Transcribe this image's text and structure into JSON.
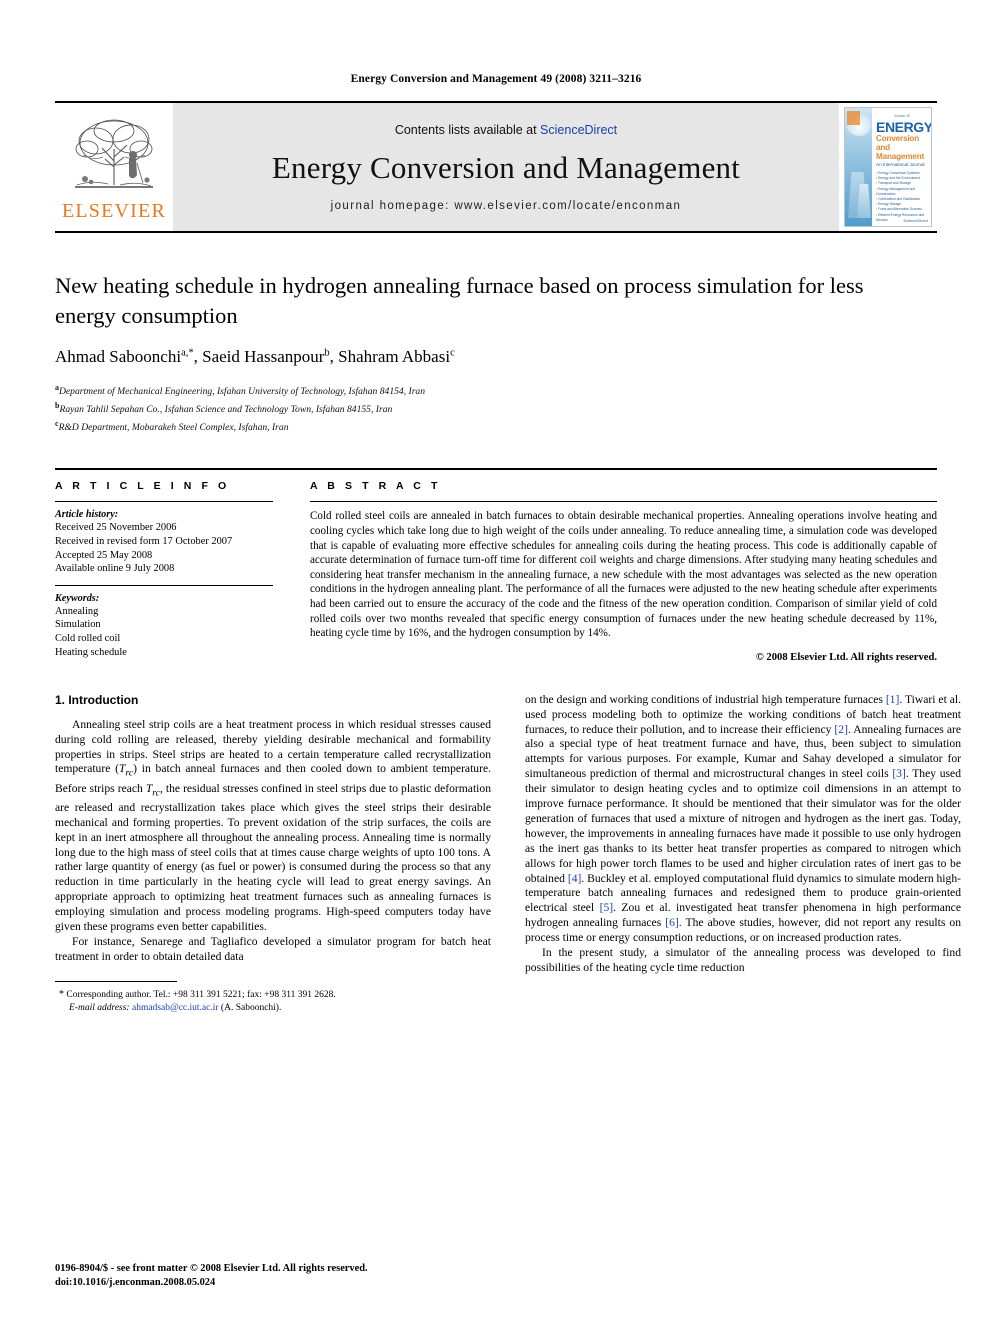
{
  "running_head": "Energy Conversion and Management 49 (2008) 3211–3216",
  "masthead": {
    "publisher_logo_label": "ELSEVIER",
    "contents_prefix": "Contents lists available at ",
    "contents_link": "ScienceDirect",
    "journal_title": "Energy Conversion and Management",
    "homepage": "journal homepage: www.elsevier.com/locate/enconman",
    "cover": {
      "issue_line": "Volume 49",
      "title_line1": "ENERGY",
      "title_line2": "Conversion and",
      "title_line3": "Management",
      "subtitle": "An International Journal",
      "topics": [
        "Energy Conversion Systems",
        "Energy and the Environment",
        "Transport and Storage",
        "Energy Management and Conservation",
        "Combustion and Gasification",
        "Energy Storage",
        "Fuels and Alternative Sources",
        "Efficient Energy Resources and Devices"
      ],
      "brand": "ScienceDirect"
    }
  },
  "article": {
    "title": "New heating schedule in hydrogen annealing furnace based on process simulation for less energy consumption",
    "authors": [
      {
        "name": "Ahmad Saboonchi",
        "marks": "a,*"
      },
      {
        "name": "Saeid Hassanpour",
        "marks": "b"
      },
      {
        "name": "Shahram Abbasi",
        "marks": "c"
      }
    ],
    "affiliations": [
      {
        "mark": "a",
        "text": "Department of Mechanical Engineering, Isfahan University of Technology, Isfahan 84154, Iran"
      },
      {
        "mark": "b",
        "text": "Rayan Tahlil Sepahan Co., Isfahan Science and Technology Town, Isfahan 84155, Iran"
      },
      {
        "mark": "c",
        "text": "R&D Department, Mobarakeh Steel Complex, Isfahan, Iran"
      }
    ]
  },
  "article_info": {
    "heading": "A R T I C L E   I N F O",
    "history_label": "Article history:",
    "history": [
      "Received 25 November 2006",
      "Received in revised form 17 October 2007",
      "Accepted 25 May 2008",
      "Available online 9 July 2008"
    ],
    "keywords_label": "Keywords:",
    "keywords": [
      "Annealing",
      "Simulation",
      "Cold rolled coil",
      "Heating schedule"
    ]
  },
  "abstract": {
    "heading": "A B S T R A C T",
    "text": "Cold rolled steel coils are annealed in batch furnaces to obtain desirable mechanical properties. Annealing operations involve heating and cooling cycles which take long due to high weight of the coils under annealing. To reduce annealing time, a simulation code was developed that is capable of evaluating more effective schedules for annealing coils during the heating process. This code is additionally capable of accurate determination of furnace turn-off time for different coil weights and charge dimensions. After studying many heating schedules and considering heat transfer mechanism in the annealing furnace, a new schedule with the most advantages was selected as the new operation conditions in the hydrogen annealing plant. The performance of all the furnaces were adjusted to the new heating schedule after experiments had been carried out to ensure the accuracy of the code and the fitness of the new operation condition. Comparison of similar yield of cold rolled coils over two months revealed that specific energy consumption of furnaces under the new heating schedule decreased by 11%, heating cycle time by 16%, and the hydrogen consumption by 14%.",
    "copyright": "© 2008 Elsevier Ltd. All rights reserved."
  },
  "body": {
    "section_title": "1. Introduction",
    "col1_para1": "Annealing steel strip coils are a heat treatment process in which residual stresses caused during cold rolling are released, thereby yielding desirable mechanical and formability properties in strips. Steel strips are heated to a certain temperature called recrystallization temperature (Trc) in batch anneal furnaces and then cooled down to ambient temperature. Before strips reach Trc, the residual stresses confined in steel strips due to plastic deformation are released and recrystallization takes place which gives the steel strips their desirable mechanical and forming properties. To prevent oxidation of the strip surfaces, the coils are kept in an inert atmosphere all throughout the annealing process. Annealing time is normally long due to the high mass of steel coils that at times cause charge weights of upto 100 tons. A rather large quantity of energy (as fuel or power) is consumed during the process so that any reduction in time particularly in the heating cycle will lead to great energy savings. An appropriate approach to optimizing heat treatment furnaces such as annealing furnaces is employing simulation and process modeling programs. High-speed computers today have given these programs even better capabilities.",
    "col1_para2": "For instance, Senarege and Tagliafico developed a simulator program for batch heat treatment in order to obtain detailed data",
    "col2_para1": "on the design and working conditions of industrial high temperature furnaces [1]. Tiwari et al. used process modeling both to optimize the working conditions of batch heat treatment furnaces, to reduce their pollution, and to increase their efficiency [2]. Annealing furnaces are also a special type of heat treatment furnace and have, thus, been subject to simulation attempts for various purposes. For example, Kumar and Sahay developed a simulator for simultaneous prediction of thermal and microstructural changes in steel coils [3]. They used their simulator to design heating cycles and to optimize coil dimensions in an attempt to improve furnace performance. It should be mentioned that their simulator was for the older generation of furnaces that used a mixture of nitrogen and hydrogen as the inert gas. Today, however, the improvements in annealing furnaces have made it possible to use only hydrogen as the inert gas thanks to its better heat transfer properties as compared to nitrogen which allows for high power torch flames to be used and higher circulation rates of inert gas to be obtained [4]. Buckley et al. employed computational fluid dynamics to simulate modern high-temperature batch annealing furnaces and redesigned them to produce grain-oriented electrical steel [5]. Zou et al. investigated heat transfer phenomena in high performance hydrogen annealing furnaces [6]. The above studies, however, did not report any results on process time or energy consumption reductions, or on increased production rates.",
    "col2_para2": "In the present study, a simulator of the annealing process was developed to find possibilities of the heating cycle time reduction"
  },
  "footnote": {
    "marker": "*",
    "line1": "Corresponding author. Tel.: +98 311 391 5221; fax: +98 311 391 2628.",
    "email_label": "E-mail address:",
    "email": "ahmadsab@cc.iut.ac.ir",
    "email_suffix": "(A. Saboonchi)."
  },
  "issn_footer": {
    "line1": "0196-8904/$ - see front matter © 2008 Elsevier Ltd. All rights reserved.",
    "line2": "doi:10.1016/j.enconman.2008.05.024"
  }
}
